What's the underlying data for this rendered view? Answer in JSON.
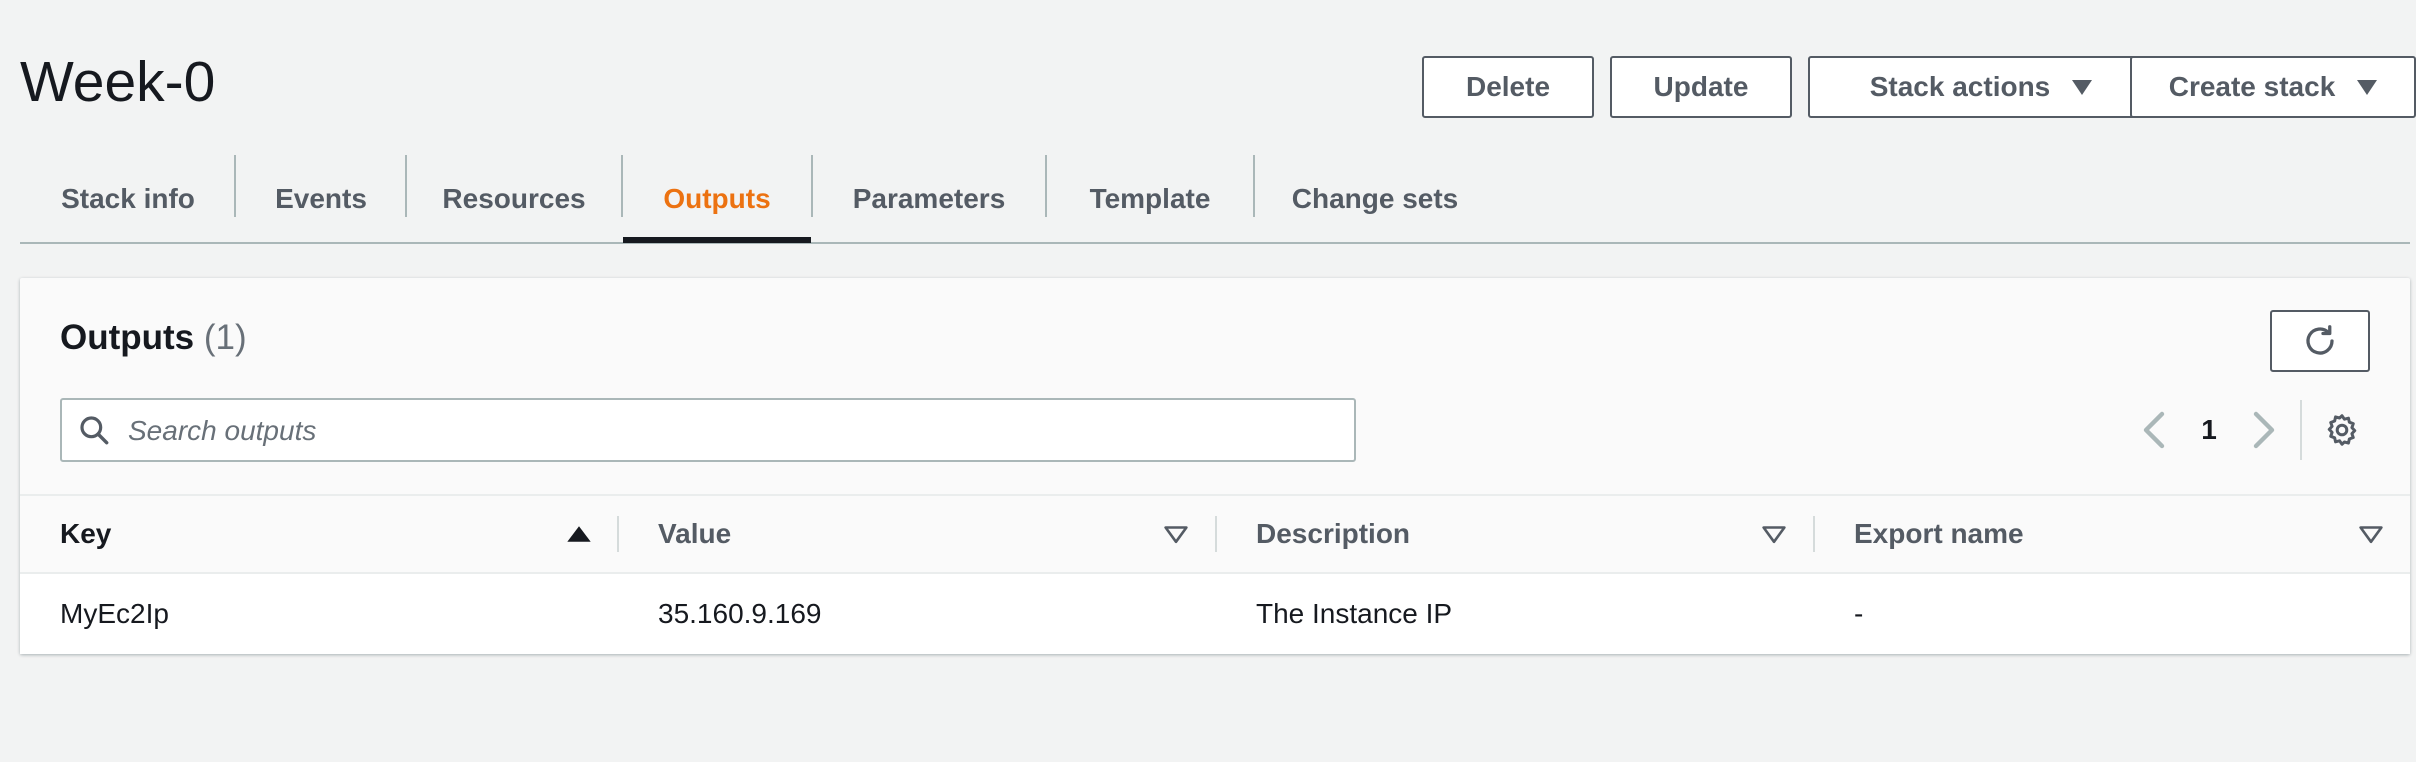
{
  "page_title": "Week-0",
  "header_buttons": {
    "delete": "Delete",
    "update": "Update",
    "stack_actions": "Stack actions",
    "create_stack": "Create stack"
  },
  "tabs": [
    {
      "label": "Stack info",
      "active": false
    },
    {
      "label": "Events",
      "active": false
    },
    {
      "label": "Resources",
      "active": false
    },
    {
      "label": "Outputs",
      "active": true
    },
    {
      "label": "Parameters",
      "active": false
    },
    {
      "label": "Template",
      "active": false
    },
    {
      "label": "Change sets",
      "active": false
    }
  ],
  "outputs_panel": {
    "title": "Outputs",
    "count": "(1)",
    "search_placeholder": "Search outputs",
    "search_value": "",
    "refresh_icon": "refresh-icon",
    "pagination": {
      "current_page": "1"
    },
    "settings_icon": "gear-icon"
  },
  "table": {
    "columns": [
      "Key",
      "Value",
      "Description",
      "Export name"
    ],
    "rows": [
      {
        "key": "MyEc2Ip",
        "value": "35.160.9.169",
        "description": "The Instance IP",
        "export_name": "-"
      }
    ]
  },
  "colors": {
    "accent": "#ec7211",
    "text": "#16191f",
    "muted": "#545b64",
    "background": "#f2f3f3"
  }
}
